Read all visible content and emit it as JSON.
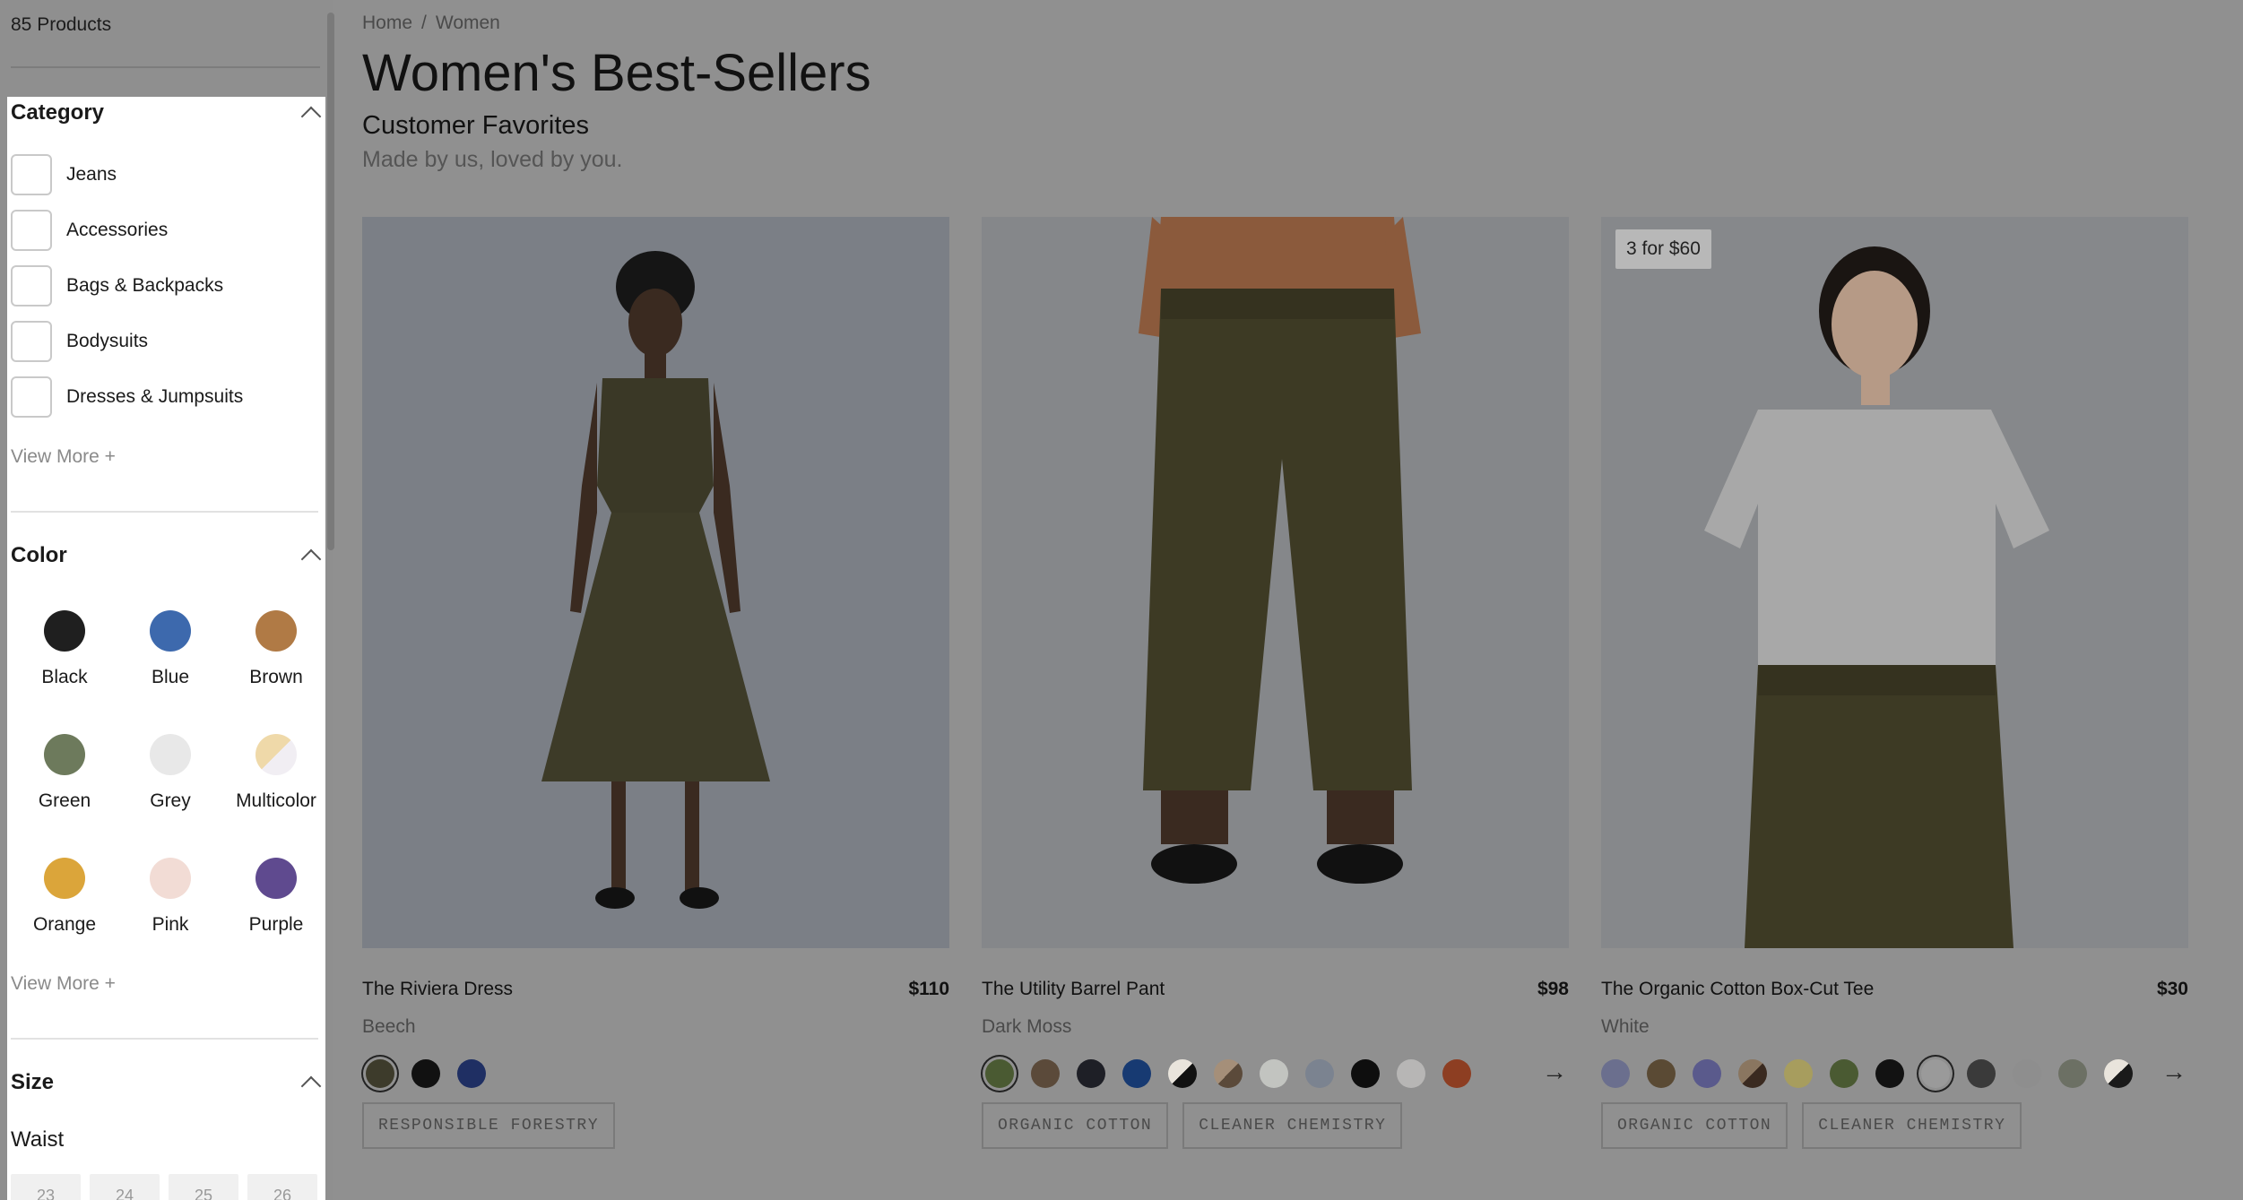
{
  "sidebar": {
    "product_count": "85 Products",
    "category": {
      "title": "Category",
      "items": [
        {
          "label": "Jeans"
        },
        {
          "label": "Accessories"
        },
        {
          "label": "Bags & Backpacks"
        },
        {
          "label": "Bodysuits"
        },
        {
          "label": "Dresses & Jumpsuits"
        }
      ],
      "view_more": "View More +"
    },
    "color": {
      "title": "Color",
      "swatches": [
        {
          "label": "Black",
          "color": "#1f1f1f"
        },
        {
          "label": "Blue",
          "color": "#3d69ad"
        },
        {
          "label": "Brown",
          "color": "#b07a45"
        },
        {
          "label": "Green",
          "color": "#6d7a5c"
        },
        {
          "label": "Grey",
          "color": "#e8e8e8"
        },
        {
          "label": "Multicolor",
          "color": "#efd9a9"
        },
        {
          "label": "Orange",
          "color": "#dba53a"
        },
        {
          "label": "Pink",
          "color": "#f2dcd5"
        },
        {
          "label": "Purple",
          "color": "#5f4a8f"
        }
      ],
      "view_more": "View More +"
    },
    "size": {
      "title": "Size",
      "waist_label": "Waist",
      "waist_options": [
        "23",
        "24",
        "25",
        "26"
      ]
    }
  },
  "breadcrumb": {
    "home": "Home",
    "separator": "/",
    "current": "Women"
  },
  "header": {
    "title": "Women's Best-Sellers",
    "subtitle": "Customer Favorites",
    "tagline": "Made by us, loved by you."
  },
  "products": [
    {
      "name": "The Riviera Dress",
      "price": "$110",
      "color_name": "Beech",
      "badge": "",
      "swatches": [
        "#3d3b2b",
        "#111111",
        "#1f2f63"
      ],
      "tags": [
        "RESPONSIBLE FORESTRY"
      ]
    },
    {
      "name": "The Utility Barrel Pant",
      "price": "$98",
      "color_name": "Dark Moss",
      "badge": "",
      "swatches": [
        "#4a5a32",
        "#5b4a3a",
        "#1e1f26",
        "#173a72",
        "#e9e4dc",
        "#a58f79",
        "#c2c4c0",
        "#7b8390",
        "#0e0e0e",
        "#b7b6b5",
        "#8d3e22"
      ],
      "tags": [
        "ORGANIC COTTON",
        "CLEANER CHEMISTRY"
      ]
    },
    {
      "name": "The Organic Cotton Box-Cut Tee",
      "price": "$30",
      "color_name": "White",
      "badge": "3 for $60",
      "swatches": [
        "#6b6f8e",
        "#5a4a34",
        "#5a5a8c",
        "#8a7660",
        "#a79d5e",
        "#4a5a32",
        "#121212",
        "#9a9a9a",
        "#3a3a3a",
        "#8e8e8e",
        "#6c7064",
        "#1a1a1a"
      ],
      "tags": [
        "ORGANIC COTTON",
        "CLEANER CHEMISTRY"
      ]
    }
  ]
}
